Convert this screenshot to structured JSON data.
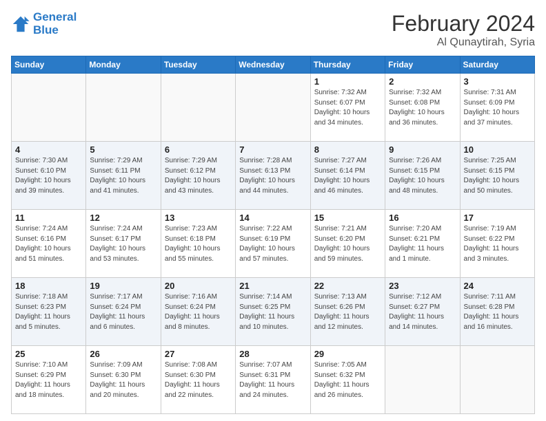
{
  "header": {
    "logo_line1": "General",
    "logo_line2": "Blue",
    "month_title": "February 2024",
    "subtitle": "Al Qunaytirah, Syria"
  },
  "weekdays": [
    "Sunday",
    "Monday",
    "Tuesday",
    "Wednesday",
    "Thursday",
    "Friday",
    "Saturday"
  ],
  "weeks": [
    [
      {
        "day": "",
        "info": ""
      },
      {
        "day": "",
        "info": ""
      },
      {
        "day": "",
        "info": ""
      },
      {
        "day": "",
        "info": ""
      },
      {
        "day": "1",
        "info": "Sunrise: 7:32 AM\nSunset: 6:07 PM\nDaylight: 10 hours\nand 34 minutes."
      },
      {
        "day": "2",
        "info": "Sunrise: 7:32 AM\nSunset: 6:08 PM\nDaylight: 10 hours\nand 36 minutes."
      },
      {
        "day": "3",
        "info": "Sunrise: 7:31 AM\nSunset: 6:09 PM\nDaylight: 10 hours\nand 37 minutes."
      }
    ],
    [
      {
        "day": "4",
        "info": "Sunrise: 7:30 AM\nSunset: 6:10 PM\nDaylight: 10 hours\nand 39 minutes."
      },
      {
        "day": "5",
        "info": "Sunrise: 7:29 AM\nSunset: 6:11 PM\nDaylight: 10 hours\nand 41 minutes."
      },
      {
        "day": "6",
        "info": "Sunrise: 7:29 AM\nSunset: 6:12 PM\nDaylight: 10 hours\nand 43 minutes."
      },
      {
        "day": "7",
        "info": "Sunrise: 7:28 AM\nSunset: 6:13 PM\nDaylight: 10 hours\nand 44 minutes."
      },
      {
        "day": "8",
        "info": "Sunrise: 7:27 AM\nSunset: 6:14 PM\nDaylight: 10 hours\nand 46 minutes."
      },
      {
        "day": "9",
        "info": "Sunrise: 7:26 AM\nSunset: 6:15 PM\nDaylight: 10 hours\nand 48 minutes."
      },
      {
        "day": "10",
        "info": "Sunrise: 7:25 AM\nSunset: 6:15 PM\nDaylight: 10 hours\nand 50 minutes."
      }
    ],
    [
      {
        "day": "11",
        "info": "Sunrise: 7:24 AM\nSunset: 6:16 PM\nDaylight: 10 hours\nand 51 minutes."
      },
      {
        "day": "12",
        "info": "Sunrise: 7:24 AM\nSunset: 6:17 PM\nDaylight: 10 hours\nand 53 minutes."
      },
      {
        "day": "13",
        "info": "Sunrise: 7:23 AM\nSunset: 6:18 PM\nDaylight: 10 hours\nand 55 minutes."
      },
      {
        "day": "14",
        "info": "Sunrise: 7:22 AM\nSunset: 6:19 PM\nDaylight: 10 hours\nand 57 minutes."
      },
      {
        "day": "15",
        "info": "Sunrise: 7:21 AM\nSunset: 6:20 PM\nDaylight: 10 hours\nand 59 minutes."
      },
      {
        "day": "16",
        "info": "Sunrise: 7:20 AM\nSunset: 6:21 PM\nDaylight: 11 hours\nand 1 minute."
      },
      {
        "day": "17",
        "info": "Sunrise: 7:19 AM\nSunset: 6:22 PM\nDaylight: 11 hours\nand 3 minutes."
      }
    ],
    [
      {
        "day": "18",
        "info": "Sunrise: 7:18 AM\nSunset: 6:23 PM\nDaylight: 11 hours\nand 5 minutes."
      },
      {
        "day": "19",
        "info": "Sunrise: 7:17 AM\nSunset: 6:24 PM\nDaylight: 11 hours\nand 6 minutes."
      },
      {
        "day": "20",
        "info": "Sunrise: 7:16 AM\nSunset: 6:24 PM\nDaylight: 11 hours\nand 8 minutes."
      },
      {
        "day": "21",
        "info": "Sunrise: 7:14 AM\nSunset: 6:25 PM\nDaylight: 11 hours\nand 10 minutes."
      },
      {
        "day": "22",
        "info": "Sunrise: 7:13 AM\nSunset: 6:26 PM\nDaylight: 11 hours\nand 12 minutes."
      },
      {
        "day": "23",
        "info": "Sunrise: 7:12 AM\nSunset: 6:27 PM\nDaylight: 11 hours\nand 14 minutes."
      },
      {
        "day": "24",
        "info": "Sunrise: 7:11 AM\nSunset: 6:28 PM\nDaylight: 11 hours\nand 16 minutes."
      }
    ],
    [
      {
        "day": "25",
        "info": "Sunrise: 7:10 AM\nSunset: 6:29 PM\nDaylight: 11 hours\nand 18 minutes."
      },
      {
        "day": "26",
        "info": "Sunrise: 7:09 AM\nSunset: 6:30 PM\nDaylight: 11 hours\nand 20 minutes."
      },
      {
        "day": "27",
        "info": "Sunrise: 7:08 AM\nSunset: 6:30 PM\nDaylight: 11 hours\nand 22 minutes."
      },
      {
        "day": "28",
        "info": "Sunrise: 7:07 AM\nSunset: 6:31 PM\nDaylight: 11 hours\nand 24 minutes."
      },
      {
        "day": "29",
        "info": "Sunrise: 7:05 AM\nSunset: 6:32 PM\nDaylight: 11 hours\nand 26 minutes."
      },
      {
        "day": "",
        "info": ""
      },
      {
        "day": "",
        "info": ""
      }
    ]
  ]
}
